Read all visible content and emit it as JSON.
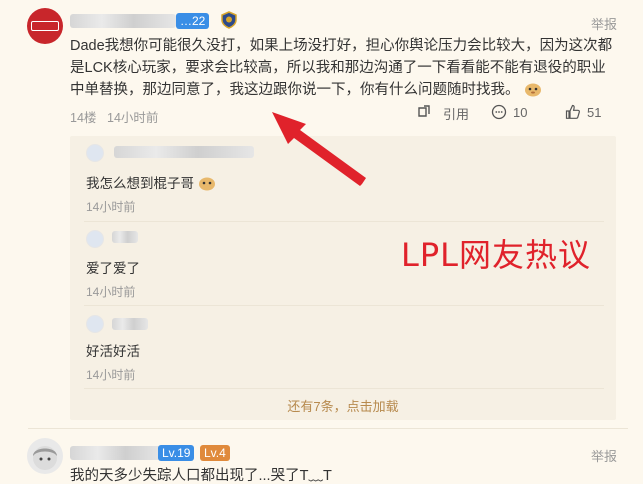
{
  "post": {
    "level_badge": "…22",
    "report_label": "举报",
    "content": "Dade我想你可能很久没打，如果上场没打好，担心你舆论压力会比较大，因为这次都是LCK核心玩家，要求会比较高，所以我和那边沟通了一下看看能不能有退役的职业中单替换，那边同意了，我这边跟你说一下，你有什么问题随时找我。",
    "floor": "14楼",
    "time": "14小时前",
    "quote_label": "引用",
    "comment_count": "10",
    "like_count": "51"
  },
  "replies": [
    {
      "text": "我怎么想到棍子哥",
      "time": "14小时前"
    },
    {
      "text": "爱了爱了",
      "time": "14小时前"
    },
    {
      "text": "好活好活",
      "time": "14小时前"
    }
  ],
  "more_replies": "还有7条，点击加载",
  "overlay_label": "LPL网友热议",
  "post2": {
    "level_badge": "Lv.19",
    "level_badge2": "Lv.4",
    "report_label": "举报",
    "content": "我的天多少失踪人口都出现了...哭了T﹏T"
  },
  "colors": {
    "accent": "#3a8ee6",
    "overlay": "#e0222b",
    "more": "#b78a4e"
  }
}
